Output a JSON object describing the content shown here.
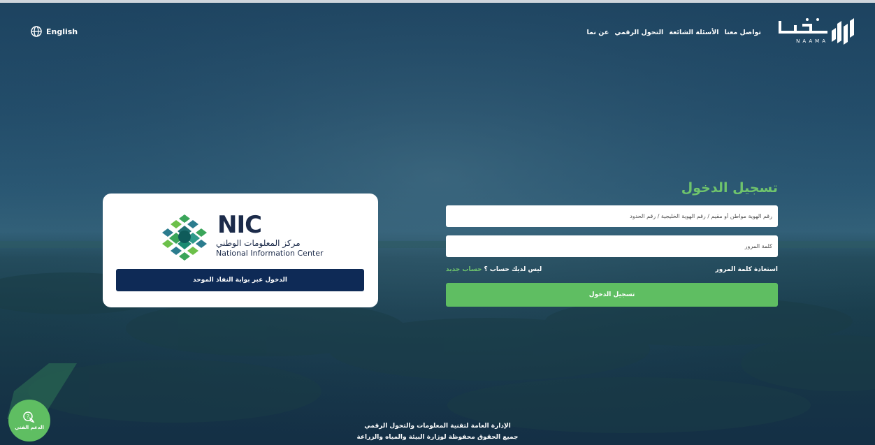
{
  "header": {
    "language_label": "English",
    "nav": [
      "عن نما",
      "التحول الرقمي",
      "الأسئلة الشائعة",
      "تواصل معنا"
    ],
    "logo_latin": "NAAMA"
  },
  "nic_card": {
    "title": "NIC",
    "arabic_name": "مركز المعلومات الوطني",
    "english_name": "National Information Center",
    "nafath_button": "الدخول عبر بوابة النفاذ الموحد"
  },
  "login": {
    "title": "تسجيل الدخول",
    "id_placeholder": "رقم الهوية مواطن أو مقيم / رقم الهوية الخليجية / رقم الحدود",
    "password_placeholder": "كلمة المرور",
    "forgot_password": "استعادة كلمة المرور",
    "no_account": "ليس لديك حساب ؟",
    "new_account": "حساب جديد",
    "submit": "تسجيل الدخول"
  },
  "footer": {
    "line1": "الإدارة العامة لتقنية المعلومات والتحول الرقمي",
    "line2": "جميع الحقوق محفوظة لوزارة البيئة والمياه والزراعة"
  },
  "support": {
    "label": "الدعم الفني"
  },
  "colors": {
    "accent_green": "#5fbe62",
    "nic_navy": "#0e2a56"
  }
}
